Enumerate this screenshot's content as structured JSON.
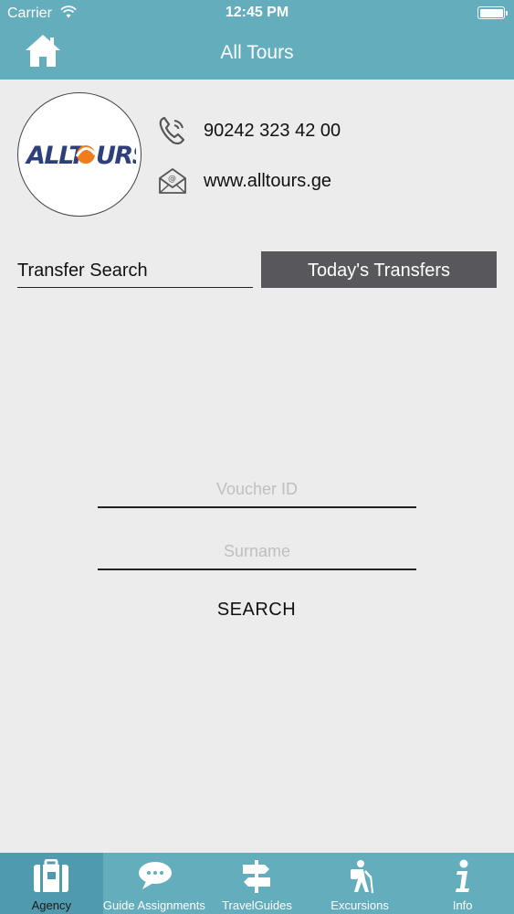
{
  "status_bar": {
    "carrier": "Carrier",
    "time": "12:45 PM"
  },
  "nav": {
    "title": "All Tours"
  },
  "agency": {
    "logo_text": "ALLTOURS",
    "phone": "90242 323 42 00",
    "website": "www.alltours.ge"
  },
  "tabs": {
    "transfer_search": "Transfer Search",
    "todays_transfers": "Today's Transfers"
  },
  "form": {
    "voucher_placeholder": "Voucher ID",
    "surname_placeholder": "Surname",
    "search_label": "SEARCH"
  },
  "tabbar": {
    "items": [
      {
        "label": "Agency",
        "icon": "suitcase-icon",
        "active": true
      },
      {
        "label": "Guide Assignments",
        "icon": "chat-bubbles-icon",
        "active": false
      },
      {
        "label": "TravelGuides",
        "icon": "signpost-icon",
        "active": false
      },
      {
        "label": "Excursions",
        "icon": "hiker-icon",
        "active": false
      },
      {
        "label": "Info",
        "icon": "info-icon",
        "active": false
      }
    ]
  },
  "colors": {
    "header": "#63adbd",
    "active_tab_bg": "#4f9aac",
    "today_button": "#58575c",
    "logo_blue": "#2e3f7a",
    "logo_orange": "#f07c1a",
    "background": "#ececec"
  }
}
